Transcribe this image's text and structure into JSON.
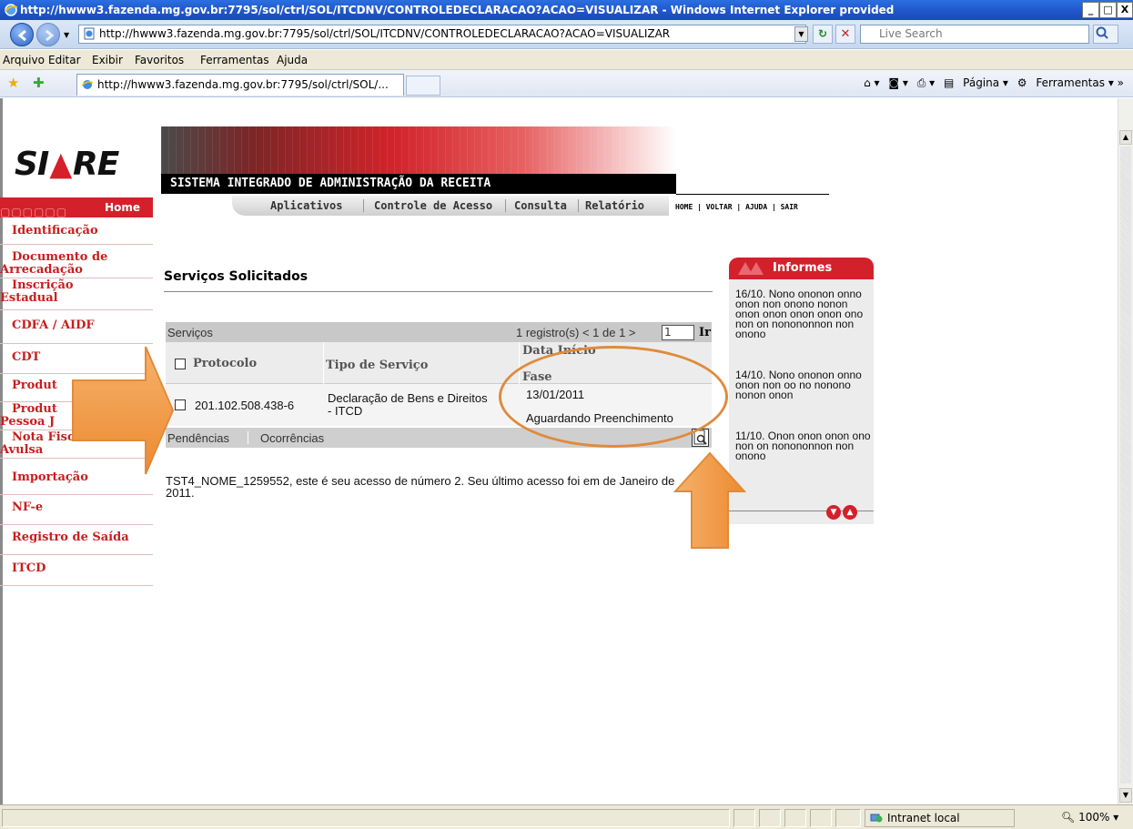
{
  "window": {
    "title": "http://hwww3.fazenda.mg.gov.br:7795/sol/ctrl/SOL/ITCDNV/CONTROLEDECLARACAO?ACAO=VISUALIZAR - Windows Internet Explorer provided",
    "min_label": "_",
    "max_label": "□",
    "close_label": "X"
  },
  "address": {
    "url": "http://hwww3.fazenda.mg.gov.br:7795/sol/ctrl/SOL/ITCDNV/CONTROLEDECLARACAO?ACAO=VISUALIZAR",
    "search_placeholder": "Live Search"
  },
  "menu": [
    "Arquivo",
    "Editar",
    "Exibir",
    "Favoritos",
    "Ferramentas",
    "Ajuda"
  ],
  "tab": {
    "title": "http://hwww3.fazenda.mg.gov.br:7795/sol/ctrl/SOL/..."
  },
  "command_bar": {
    "page_label": "Página",
    "tools_label": "Ferramentas"
  },
  "siare": {
    "logo_left": "SI",
    "logo_right": "RE",
    "system_title": "SISTEMA INTEGRADO DE ADMINISTRAÇÃO DA RECEITA",
    "app_menu": [
      "Aplicativos",
      "Controle de Acesso",
      "Consulta",
      "Relatório"
    ],
    "top_links": "HOME | VOLTAR | AJUDA | SAIR"
  },
  "sidebar": {
    "home": "Home",
    "items": [
      {
        "label": "Identificação"
      },
      {
        "label": "Documento de",
        "label2": "Arrecadação"
      },
      {
        "label": "Inscrição",
        "label2": "Estadual"
      },
      {
        "label": "CDFA / AIDF"
      },
      {
        "label": "CDT"
      },
      {
        "label": "Produt"
      },
      {
        "label": "Produt",
        "label2": "Pessoa J"
      },
      {
        "label": "Nota Fiscal",
        "label2": "Avulsa"
      },
      {
        "label": "Importação"
      },
      {
        "label": "NF-e"
      },
      {
        "label": "Registro de Saída"
      },
      {
        "label": "ITCD"
      }
    ]
  },
  "services": {
    "title": "Serviços Solicitados",
    "header_label": "Serviços",
    "pager": "1 registro(s) < 1 de 1 >",
    "page_value": "1",
    "go_label": "Ir",
    "columns": {
      "protocol": "Protocolo",
      "type": "Tipo de Serviço",
      "start_date": "Data Início",
      "phase": "Fase"
    },
    "rows": [
      {
        "protocol": "201.102.508.438-6",
        "type_line1": "Declaração de Bens e Direitos",
        "type_line2": "- ITCD",
        "start_date": "13/01/2011",
        "phase": "Aguardando Preenchimento"
      }
    ],
    "footer": [
      "Pendências",
      "Ocorrências"
    ]
  },
  "welcome": "TST4_NOME_1259552, este é seu acesso de número 2. Seu último acesso foi em de Janeiro de 2011.",
  "informes": {
    "title": "Informes",
    "news": [
      "16/10. Nono ononon onno onon non onono nonon onon onon onon onon ono non on nonononnon non onono",
      "14/10. Nono ononon onno onon non oo no nonono nonon onon",
      "11/10. Onon onon onon ono non on nonononnon non onono"
    ]
  },
  "statusbar": {
    "zone": "Intranet local",
    "zoom": "100%"
  },
  "colors": {
    "accent_red": "#d4202b",
    "annotation_orange": "#f08c2e"
  }
}
